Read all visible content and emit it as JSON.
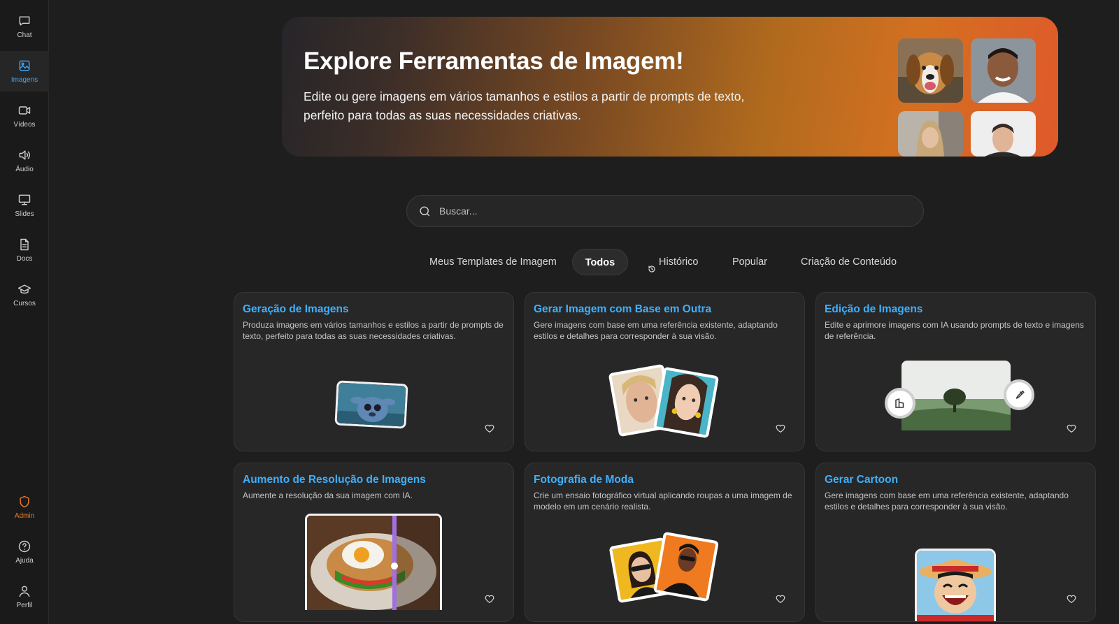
{
  "sidebar": {
    "items": [
      {
        "label": "Chat",
        "icon": "chat-icon"
      },
      {
        "label": "Imagens",
        "icon": "image-icon",
        "active": true
      },
      {
        "label": "Vídeos",
        "icon": "video-icon"
      },
      {
        "label": "Áudio",
        "icon": "speaker-icon"
      },
      {
        "label": "Slides",
        "icon": "presentation-icon"
      },
      {
        "label": "Docs",
        "icon": "document-icon"
      },
      {
        "label": "Cursos",
        "icon": "graduation-cap-icon"
      }
    ],
    "bottom": [
      {
        "label": "Admin",
        "icon": "shield-icon"
      },
      {
        "label": "Ajuda",
        "icon": "help-icon"
      },
      {
        "label": "Perfil",
        "icon": "user-icon"
      }
    ]
  },
  "hero": {
    "title": "Explore Ferramentas de Imagem!",
    "subtitle": "Edite ou gere imagens em vários tamanhos e estilos a partir de prompts de texto, perfeito para todas as suas necessidades criativas."
  },
  "search": {
    "placeholder": "Buscar..."
  },
  "tabs": [
    "Meus Templates de Imagem",
    "Todos",
    "Histórico",
    "Popular",
    "Criação de Conteúdo"
  ],
  "active_tab": "Todos",
  "cards": [
    {
      "title": "Geração de Imagens",
      "desc": "Produza imagens em vários tamanhos e estilos a partir de prompts de texto, perfeito para todas as suas necessidades criativas."
    },
    {
      "title": "Gerar Imagem com Base em Outra",
      "desc": "Gere imagens com base em uma referência existente, adaptando estilos e detalhes para corresponder à sua visão."
    },
    {
      "title": "Edição de Imagens",
      "desc": "Edite e aprimore imagens com IA usando prompts de texto e imagens de referência."
    },
    {
      "title": "Aumento de Resolução de Imagens",
      "desc": "Aumente a resolução da sua imagem com IA."
    },
    {
      "title": "Fotografia de Moda",
      "desc": "Crie um ensaio fotográfico virtual aplicando roupas a uma imagem de modelo em um cenário realista."
    },
    {
      "title": "Gerar Cartoon",
      "desc": "Gere imagens com base em uma referência existente, adaptando estilos e detalhes para corresponder à sua visão."
    }
  ],
  "colors": {
    "accent": "#3fb0ff",
    "admin": "#f07a2a",
    "background": "#1e1e1e"
  }
}
